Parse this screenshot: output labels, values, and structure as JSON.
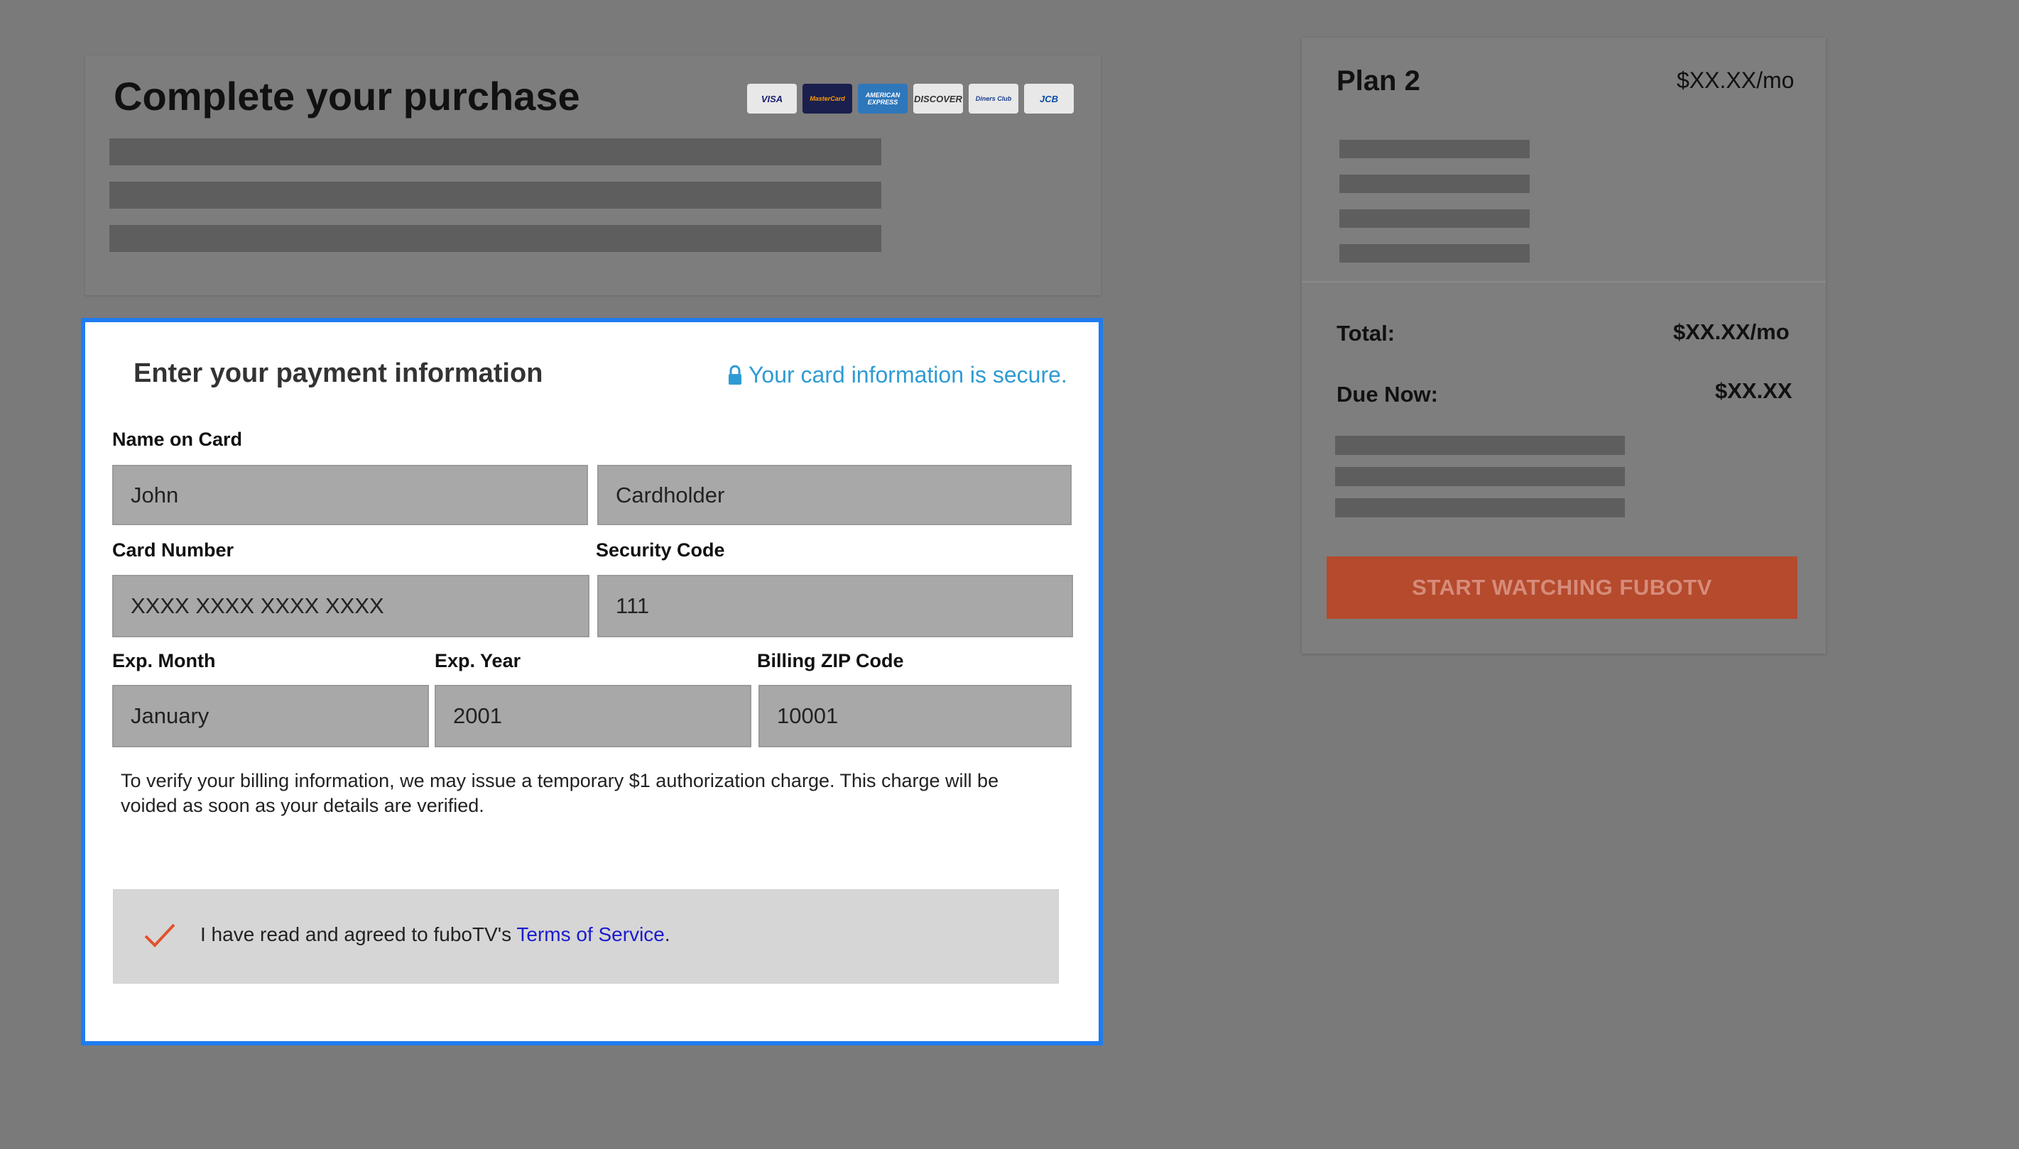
{
  "purchase": {
    "title": "Complete your purchase",
    "card_logos": [
      {
        "name": "visa",
        "text": "VISA",
        "bg": "#e8e8e8",
        "fg": "#1a1f71"
      },
      {
        "name": "mastercard",
        "text": "MasterCard",
        "bg": "#1a1f4d",
        "fg": "#ff9a00"
      },
      {
        "name": "amex",
        "text": "AMERICAN EXPRESS",
        "bg": "#2e77bb",
        "fg": "#ffffff"
      },
      {
        "name": "discover",
        "text": "DISCOVER",
        "bg": "#e8e8e8",
        "fg": "#333333"
      },
      {
        "name": "diners",
        "text": "Diners Club",
        "bg": "#e8e8e8",
        "fg": "#1a3e8c"
      },
      {
        "name": "jcb",
        "text": "JCB",
        "bg": "#e8e8e8",
        "fg": "#0b4ea2"
      }
    ]
  },
  "form": {
    "heading": "Enter your payment information",
    "secure_text": "Your card information is secure.",
    "name_label": "Name on Card",
    "first_name": "John",
    "last_name": "Cardholder",
    "card_number_label": "Card Number",
    "card_number": "XXXX XXXX XXXX XXXX",
    "security_code_label": "Security Code",
    "security_code": "111",
    "exp_month_label": "Exp. Month",
    "exp_month": "January",
    "exp_year_label": "Exp. Year",
    "exp_year": "2001",
    "zip_label": "Billing ZIP Code",
    "zip": "10001",
    "notice": "To verify your billing information, we may issue a temporary $1 authorization charge. This charge will be voided as soon as your details are verified.",
    "tos_prefix": "I have read and agreed to fuboTV's ",
    "tos_link": "Terms of Service",
    "tos_suffix": ".",
    "tos_checked": true
  },
  "plan": {
    "name": "Plan 2",
    "price": "$XX.XX/mo",
    "total_label": "Total:",
    "total_value": "$XX.XX/mo",
    "due_label": "Due Now:",
    "due_value": "$XX.XX",
    "cta_label": "START WATCHING FUBOTV"
  },
  "colors": {
    "accent_border": "#1e7cf0",
    "secure_text": "#2f9bd4",
    "cta_bg": "#b54a2d",
    "check": "#e0522b",
    "link": "#1b1bd0"
  }
}
